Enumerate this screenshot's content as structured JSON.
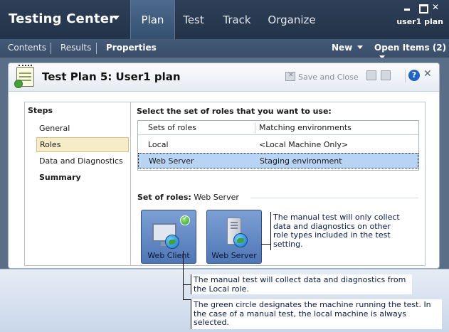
{
  "header": {
    "app_title": "Testing Center",
    "tabs": [
      {
        "label": "Plan",
        "active": true
      },
      {
        "label": "Test",
        "active": false
      },
      {
        "label": "Track",
        "active": false
      },
      {
        "label": "Organize",
        "active": false
      }
    ],
    "user": "user1 plan"
  },
  "subnav": {
    "items": [
      {
        "label": "Contents",
        "active": false
      },
      {
        "label": "Results",
        "active": false
      },
      {
        "label": "Properties",
        "active": true
      }
    ],
    "new_label": "New",
    "open_items_label": "Open Items (2)"
  },
  "card": {
    "title": "Test Plan 5: User1 plan",
    "save_close_label": "Save and Close"
  },
  "steps": {
    "title": "Steps",
    "items": [
      {
        "label": "General",
        "selected": false,
        "bold": false
      },
      {
        "label": "Roles",
        "selected": true,
        "bold": false
      },
      {
        "label": "Data and Diagnostics",
        "selected": false,
        "bold": false
      },
      {
        "label": "Summary",
        "selected": false,
        "bold": true
      }
    ]
  },
  "roles": {
    "instruction": "Select the set of roles that you want to use:",
    "columns": [
      "Sets of roles",
      "Matching environments"
    ],
    "rows": [
      {
        "set": "Local",
        "environment": "<Local Machine Only>",
        "selected": false
      },
      {
        "set": "Web Server",
        "environment": "Staging environment",
        "selected": true
      }
    ],
    "set_of_roles_label": "Set of roles:",
    "set_of_roles_value": "Web Server",
    "tiles": [
      {
        "label": "Web Client",
        "icon": "monitor-globe-icon",
        "local": true
      },
      {
        "label": "Web Server",
        "icon": "server-globe-icon",
        "local": false
      }
    ]
  },
  "callouts": {
    "right": "The manual test will only collect data and diagnostics on other role types included in the test setting.",
    "local_role": "The manual test will collect data and diagnostics from the Local role.",
    "green_circle": "The green circle designates the machine running the test. In the case of a manual test, the local machine is always selected."
  },
  "colors": {
    "header_bg": "#2e3f58",
    "active_tab": "#4d6a8f",
    "tile_blue": "#5b82c0",
    "selected_row": "#b8d4f4",
    "selected_step": "#f6ecc8",
    "callout_text": "#0a1a4a"
  }
}
